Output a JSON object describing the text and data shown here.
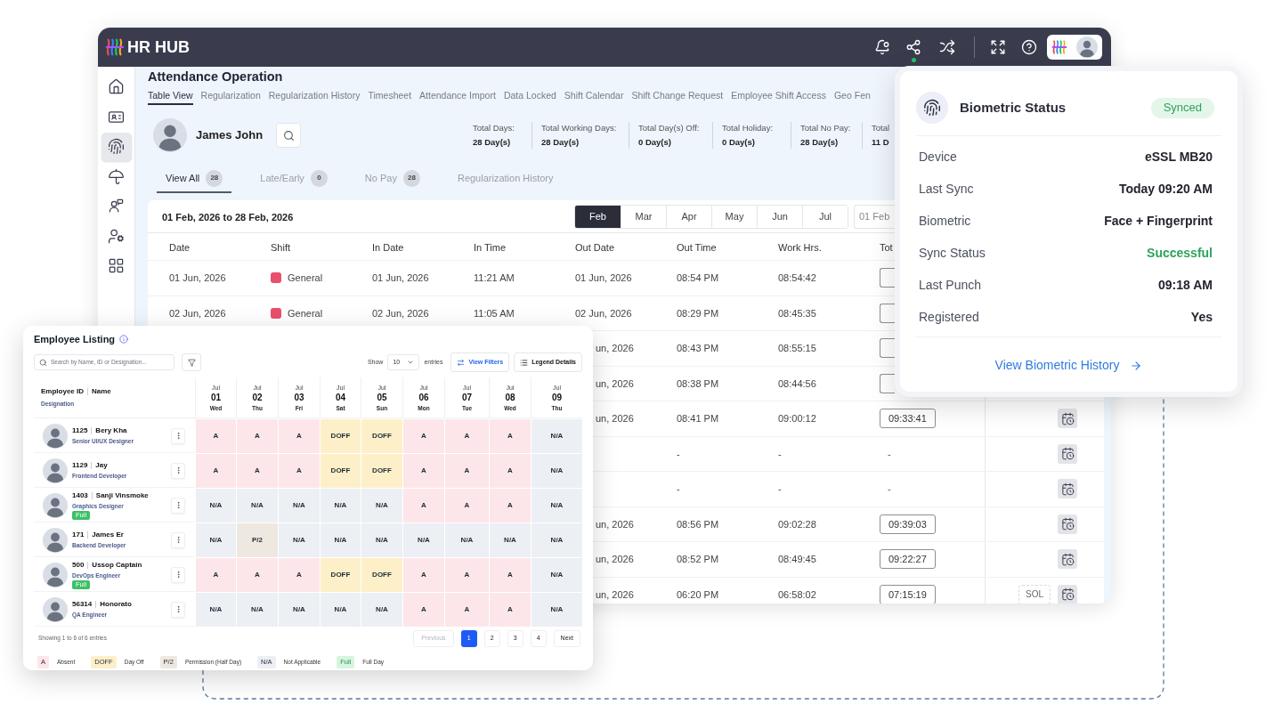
{
  "window": {
    "brand": "HR HUB"
  },
  "sidebar": {
    "items": [
      {
        "kind": "home",
        "selected": false
      },
      {
        "kind": "id_card",
        "selected": false
      },
      {
        "kind": "fingerprint",
        "selected": true
      },
      {
        "kind": "umbrella",
        "selected": false
      },
      {
        "kind": "user_chat",
        "selected": false
      },
      {
        "kind": "user_gear",
        "selected": false
      },
      {
        "kind": "grid",
        "selected": false
      }
    ]
  },
  "page": {
    "title": "Attendance Operation",
    "tabs": [
      {
        "label": "Table View",
        "selected": true
      },
      {
        "label": "Regularization",
        "selected": false
      },
      {
        "label": "Regularization History",
        "selected": false
      },
      {
        "label": "Timesheet",
        "selected": false
      },
      {
        "label": "Attendance Import",
        "selected": false
      },
      {
        "label": "Data Locked",
        "selected": false
      },
      {
        "label": "Shift Calendar",
        "selected": false
      },
      {
        "label": "Shift Change Request",
        "selected": false
      },
      {
        "label": "Employee Shift Access",
        "selected": false
      },
      {
        "label": "Geo Fen",
        "selected": false
      }
    ]
  },
  "employee": {
    "name": "James John",
    "stats": [
      {
        "label": "Total Days:",
        "value": "28 Day(s)"
      },
      {
        "label": "Total Working Days:",
        "value": "28 Day(s)"
      },
      {
        "label": "Total Day(s) Off:",
        "value": "0 Day(s)"
      },
      {
        "label": "Total Holiday:",
        "value": "0 Day(s)"
      },
      {
        "label": "Total No Pay:",
        "value": "28 Day(s)"
      },
      {
        "label": "Total",
        "value": "11 D"
      }
    ]
  },
  "filters": [
    {
      "label": "View All",
      "count": "28",
      "selected": true
    },
    {
      "label": "Late/Early",
      "count": "0",
      "selected": false
    },
    {
      "label": "No Pay",
      "count": "28",
      "selected": false
    },
    {
      "label": "Regularization History",
      "selected": false
    }
  ],
  "period": {
    "range": "01 Feb, 2026 to 28 Feb, 2026",
    "months": [
      {
        "label": "Feb",
        "selected": true
      },
      {
        "label": "Mar",
        "selected": false
      },
      {
        "label": "Apr",
        "selected": false
      },
      {
        "label": "May",
        "selected": false
      },
      {
        "label": "Jun",
        "selected": false
      },
      {
        "label": "Jul",
        "selected": false
      }
    ],
    "date_field": "01 Feb"
  },
  "table": {
    "columns": [
      "Date",
      "Shift",
      "In Date",
      "In Time",
      "Out Date",
      "Out Time",
      "Work Hrs.",
      "Tot"
    ],
    "rows": [
      {
        "kind": "full",
        "date": "01 Jun, 2026",
        "shift": {
          "name": "General",
          "color": "#e8506b"
        },
        "in_date": "01 Jun, 2026",
        "in_time": "11:21 AM",
        "out_date": "01 Jun, 2026",
        "out_time": "08:54 PM",
        "work_hrs": "08:54:42",
        "total": {
          "kind": "covered"
        },
        "schedule_button": false
      },
      {
        "kind": "full",
        "date": "02 Jun, 2026",
        "shift": {
          "name": "General",
          "color": "#e8506b"
        },
        "in_date": "02 Jun, 2026",
        "in_time": "11:05 AM",
        "out_date": "02 Jun, 2026",
        "out_time": "08:29 PM",
        "work_hrs": "08:45:35",
        "total": {
          "kind": "covered"
        },
        "schedule_button": false
      },
      {
        "kind": "partial",
        "out_date": "un, 2026",
        "out_time": "08:43 PM",
        "work_hrs": "08:55:15",
        "total": {
          "kind": "covered"
        },
        "schedule_button": false
      },
      {
        "kind": "partial",
        "out_date": "un, 2026",
        "out_time": "08:38 PM",
        "work_hrs": "08:44:56",
        "total": {
          "kind": "covered"
        },
        "schedule_button": false
      },
      {
        "kind": "partial",
        "out_date": "un, 2026",
        "out_time": "08:41 PM",
        "work_hrs": "09:00:12",
        "total": {
          "kind": "pill",
          "text": "09:33:41"
        },
        "schedule_button": true
      },
      {
        "kind": "partial",
        "out_time": "-",
        "work_hrs": "-",
        "total": {
          "kind": "dash",
          "text": "-"
        },
        "schedule_button": true
      },
      {
        "kind": "partial",
        "out_time": "-",
        "work_hrs": "-",
        "total": {
          "kind": "dash",
          "text": "-"
        },
        "schedule_button": true
      },
      {
        "kind": "partial",
        "out_date": "un, 2026",
        "out_time": "08:56 PM",
        "work_hrs": "09:02:28",
        "total": {
          "kind": "pill",
          "text": "09:39:03"
        },
        "schedule_button": true
      },
      {
        "kind": "partial",
        "out_date": "un, 2026",
        "out_time": "08:52 PM",
        "work_hrs": "08:49:45",
        "total": {
          "kind": "pill",
          "text": "09:22:27"
        },
        "schedule_button": true
      },
      {
        "kind": "partial",
        "out_date": "un, 2026",
        "out_time": "06:20 PM",
        "work_hrs": "06:58:02",
        "total": {
          "kind": "pill",
          "text": "07:15:19"
        },
        "tag": "SOL",
        "schedule_button": true
      }
    ]
  },
  "employee_listing": {
    "title": "Employee Listing",
    "search": {
      "placeholder": "Search by Name, ID or Designation..."
    },
    "show_label": "Show",
    "page_size": "10",
    "entries_label": "entries",
    "buttons": [
      {
        "kind": "filters",
        "label": "View Filters"
      },
      {
        "kind": "legend",
        "label": "Legend Details"
      }
    ],
    "header": {
      "id_label": "Employee ID",
      "name_label": "Name",
      "designation_label": "Designation"
    },
    "days": [
      {
        "month": "Jul",
        "day": "01",
        "weekday": "Wed"
      },
      {
        "month": "Jul",
        "day": "02",
        "weekday": "Thu"
      },
      {
        "month": "Jul",
        "day": "03",
        "weekday": "Fri"
      },
      {
        "month": "Jul",
        "day": "04",
        "weekday": "Sat"
      },
      {
        "month": "Jul",
        "day": "05",
        "weekday": "Sun"
      },
      {
        "month": "Jul",
        "day": "06",
        "weekday": "Mon"
      },
      {
        "month": "Jul",
        "day": "07",
        "weekday": "Tue"
      },
      {
        "month": "Jul",
        "day": "08",
        "weekday": "Wed"
      },
      {
        "month": "Jul",
        "day": "09",
        "weekday": "Thu"
      }
    ],
    "rows": [
      {
        "id": "1125",
        "name": "Bery Kha",
        "designation": "Senior UI/UX Designer",
        "cells": [
          {
            "kind": "absent",
            "text": "A"
          },
          {
            "kind": "absent",
            "text": "A"
          },
          {
            "kind": "absent",
            "text": "A"
          },
          {
            "kind": "dayoff",
            "text": "DOFF"
          },
          {
            "kind": "dayoff",
            "text": "DOFF"
          },
          {
            "kind": "absent",
            "text": "A"
          },
          {
            "kind": "absent",
            "text": "A"
          },
          {
            "kind": "absent",
            "text": "A"
          },
          {
            "kind": "na",
            "text": "N/A"
          }
        ]
      },
      {
        "id": "1129",
        "name": "Jay",
        "designation": "Frontend Developer",
        "cells": [
          {
            "kind": "absent",
            "text": "A"
          },
          {
            "kind": "absent",
            "text": "A"
          },
          {
            "kind": "absent",
            "text": "A"
          },
          {
            "kind": "dayoff",
            "text": "DOFF"
          },
          {
            "kind": "dayoff",
            "text": "DOFF"
          },
          {
            "kind": "absent",
            "text": "A"
          },
          {
            "kind": "absent",
            "text": "A"
          },
          {
            "kind": "absent",
            "text": "A"
          },
          {
            "kind": "na",
            "text": "N/A"
          }
        ]
      },
      {
        "id": "1403",
        "name": "Sanji Vinsmoke",
        "designation": "Graphics Designer",
        "badge": "Full",
        "cells": [
          {
            "kind": "na",
            "text": "N/A"
          },
          {
            "kind": "na",
            "text": "N/A"
          },
          {
            "kind": "na",
            "text": "N/A"
          },
          {
            "kind": "na",
            "text": "N/A"
          },
          {
            "kind": "na",
            "text": "N/A"
          },
          {
            "kind": "absent",
            "text": "A"
          },
          {
            "kind": "absent",
            "text": "A"
          },
          {
            "kind": "absent",
            "text": "A"
          },
          {
            "kind": "na",
            "text": "N/A"
          }
        ]
      },
      {
        "id": "171",
        "name": "James Er",
        "designation": "Backend Developer",
        "cells": [
          {
            "kind": "na",
            "text": "N/A"
          },
          {
            "kind": "permission",
            "text": "P/2"
          },
          {
            "kind": "na",
            "text": "N/A"
          },
          {
            "kind": "na",
            "text": "N/A"
          },
          {
            "kind": "na",
            "text": "N/A"
          },
          {
            "kind": "na",
            "text": "N/A"
          },
          {
            "kind": "na",
            "text": "N/A"
          },
          {
            "kind": "na",
            "text": "N/A"
          },
          {
            "kind": "na",
            "text": "N/A"
          }
        ]
      },
      {
        "id": "500",
        "name": "Ussop Captain",
        "designation": "DevOps Engineer",
        "badge": "Full",
        "cells": [
          {
            "kind": "absent",
            "text": "A"
          },
          {
            "kind": "absent",
            "text": "A"
          },
          {
            "kind": "absent",
            "text": "A"
          },
          {
            "kind": "dayoff",
            "text": "DOFF"
          },
          {
            "kind": "dayoff",
            "text": "DOFF"
          },
          {
            "kind": "absent",
            "text": "A"
          },
          {
            "kind": "absent",
            "text": "A"
          },
          {
            "kind": "absent",
            "text": "A"
          },
          {
            "kind": "na",
            "text": "N/A"
          }
        ]
      },
      {
        "id": "56314",
        "name": "Honorato",
        "designation": "QA Engineer",
        "cells": [
          {
            "kind": "na",
            "text": "N/A"
          },
          {
            "kind": "na",
            "text": "N/A"
          },
          {
            "kind": "na",
            "text": "N/A"
          },
          {
            "kind": "na",
            "text": "N/A"
          },
          {
            "kind": "na",
            "text": "N/A"
          },
          {
            "kind": "absent",
            "text": "A"
          },
          {
            "kind": "absent",
            "text": "A"
          },
          {
            "kind": "absent",
            "text": "A"
          },
          {
            "kind": "na",
            "text": "N/A"
          }
        ]
      }
    ],
    "summary": "Showing 1 to 6 of 6 entries",
    "pagination": {
      "previous": {
        "label": "Previous",
        "disabled": true
      },
      "pages": [
        {
          "label": "1",
          "selected": true
        },
        {
          "label": "2",
          "selected": false
        },
        {
          "label": "3",
          "selected": false
        },
        {
          "label": "4",
          "selected": false
        }
      ],
      "next": {
        "label": "Next",
        "disabled": false
      }
    },
    "legend": [
      {
        "kind": "absent",
        "code": "A",
        "label": "Absent"
      },
      {
        "kind": "dayoff",
        "code": "DOFF",
        "label": "Day Off"
      },
      {
        "kind": "permission",
        "code": "P/2",
        "label": "Permission (Half Day)"
      },
      {
        "kind": "na",
        "code": "N/A",
        "label": "Not Applicable"
      },
      {
        "kind": "full",
        "code": "Full",
        "label": "Full Day"
      }
    ]
  },
  "biometric_status": {
    "title": "Biometric Status",
    "badge": "Synced",
    "rows": [
      {
        "label": "Device",
        "value": "eSSL MB20",
        "kind": "plain"
      },
      {
        "label": "Last Sync",
        "value": "Today 09:20 AM",
        "kind": "plain"
      },
      {
        "label": "Biometric",
        "value": "Face + Fingerprint",
        "kind": "plain"
      },
      {
        "label": "Sync Status",
        "value": "Successful",
        "kind": "success"
      },
      {
        "label": "Last Punch",
        "value": "09:18 AM",
        "kind": "plain"
      },
      {
        "label": "Registered",
        "value": "Yes",
        "kind": "plain"
      }
    ],
    "link": "View Biometric History"
  }
}
